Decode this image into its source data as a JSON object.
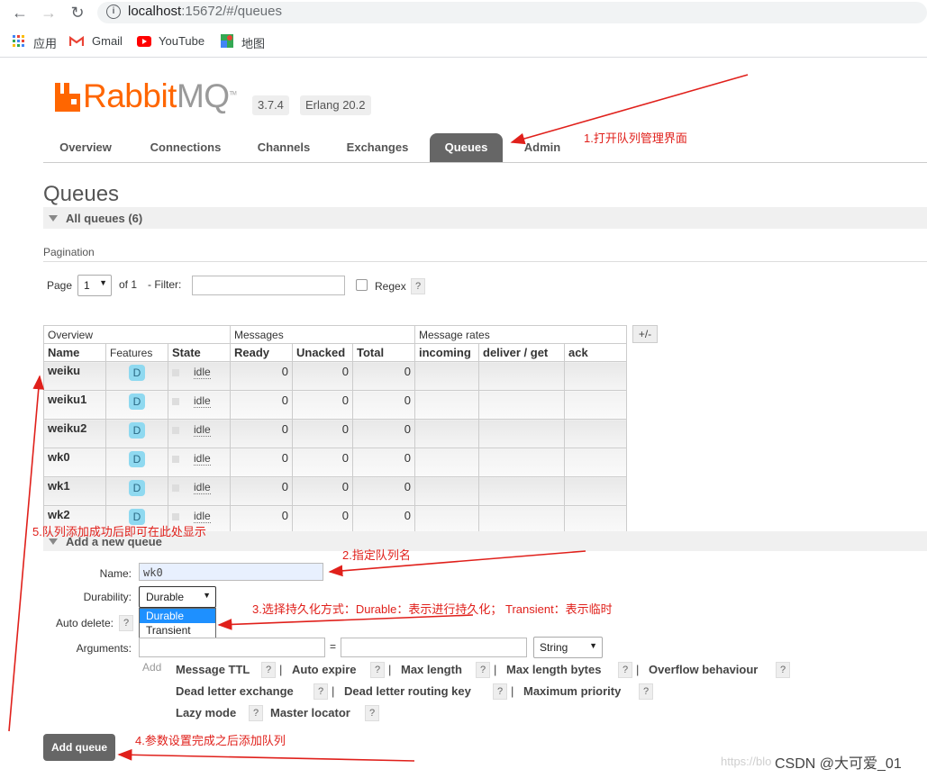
{
  "browser": {
    "url_host": "localhost",
    "url_rest": ":15672/#/queues",
    "bookmarks": [
      "应用",
      "Gmail",
      "YouTube",
      "地图"
    ]
  },
  "header": {
    "logo_a": "Rabbit",
    "logo_b": "MQ",
    "logo_tm": "TM",
    "version": "3.7.4",
    "erlang": "Erlang 20.2"
  },
  "tabs": [
    "Overview",
    "Connections",
    "Channels",
    "Exchanges",
    "Queues",
    "Admin"
  ],
  "active_tab": "Queues",
  "page_title": "Queues",
  "all_queues_label": "All queues (6)",
  "pagination": {
    "label": "Pagination",
    "page_label": "Page",
    "page_value": "1",
    "of_label": "of 1",
    "filter_label": "- Filter:",
    "filter_value": "",
    "regex_label": "Regex",
    "help": "?"
  },
  "table": {
    "groups": [
      "Overview",
      "Messages",
      "Message rates"
    ],
    "columns": [
      "Name",
      "Features",
      "State",
      "Ready",
      "Unacked",
      "Total",
      "incoming",
      "deliver / get",
      "ack"
    ],
    "rows": [
      {
        "name": "weiku",
        "feature": "D",
        "state": "idle",
        "ready": "0",
        "unacked": "0",
        "total": "0"
      },
      {
        "name": "weiku1",
        "feature": "D",
        "state": "idle",
        "ready": "0",
        "unacked": "0",
        "total": "0"
      },
      {
        "name": "weiku2",
        "feature": "D",
        "state": "idle",
        "ready": "0",
        "unacked": "0",
        "total": "0"
      },
      {
        "name": "wk0",
        "feature": "D",
        "state": "idle",
        "ready": "0",
        "unacked": "0",
        "total": "0"
      },
      {
        "name": "wk1",
        "feature": "D",
        "state": "idle",
        "ready": "0",
        "unacked": "0",
        "total": "0"
      },
      {
        "name": "wk2",
        "feature": "D",
        "state": "idle",
        "ready": "0",
        "unacked": "0",
        "total": "0"
      }
    ],
    "plus_minus": "+/-"
  },
  "add_queue": {
    "section_label": "Add a new queue",
    "name_label": "Name:",
    "name_value": "wk0",
    "durability_label": "Durability:",
    "durability_value": "Durable",
    "durability_options": [
      "Durable",
      "Transient"
    ],
    "auto_delete_label": "Auto delete:",
    "arguments_label": "Arguments:",
    "equals": "=",
    "arg_type": "String",
    "add_link": "Add",
    "arg_links": [
      "Message TTL",
      "Auto expire",
      "Max length",
      "Max length bytes",
      "Overflow behaviour",
      "Dead letter exchange",
      "Dead letter routing key",
      "Maximum priority",
      "Lazy mode",
      "Master locator"
    ],
    "submit": "Add queue"
  },
  "annotations": {
    "a1": "1.打开队列管理界面",
    "a2": "2.指定队列名",
    "a3": "3.选择持久化方式：Durable：表示进行持久化； Transient：表示临时",
    "a4": "4.参数设置完成之后添加队列",
    "a5": "5.队列添加成功后即可在此处显示"
  },
  "watermark": "CSDN @大可爱_01",
  "watermark_faint": "https://blo",
  "colors": {
    "brand": "#ff6600",
    "annotation": "#e0201b",
    "badge": "#8fd9f0"
  }
}
